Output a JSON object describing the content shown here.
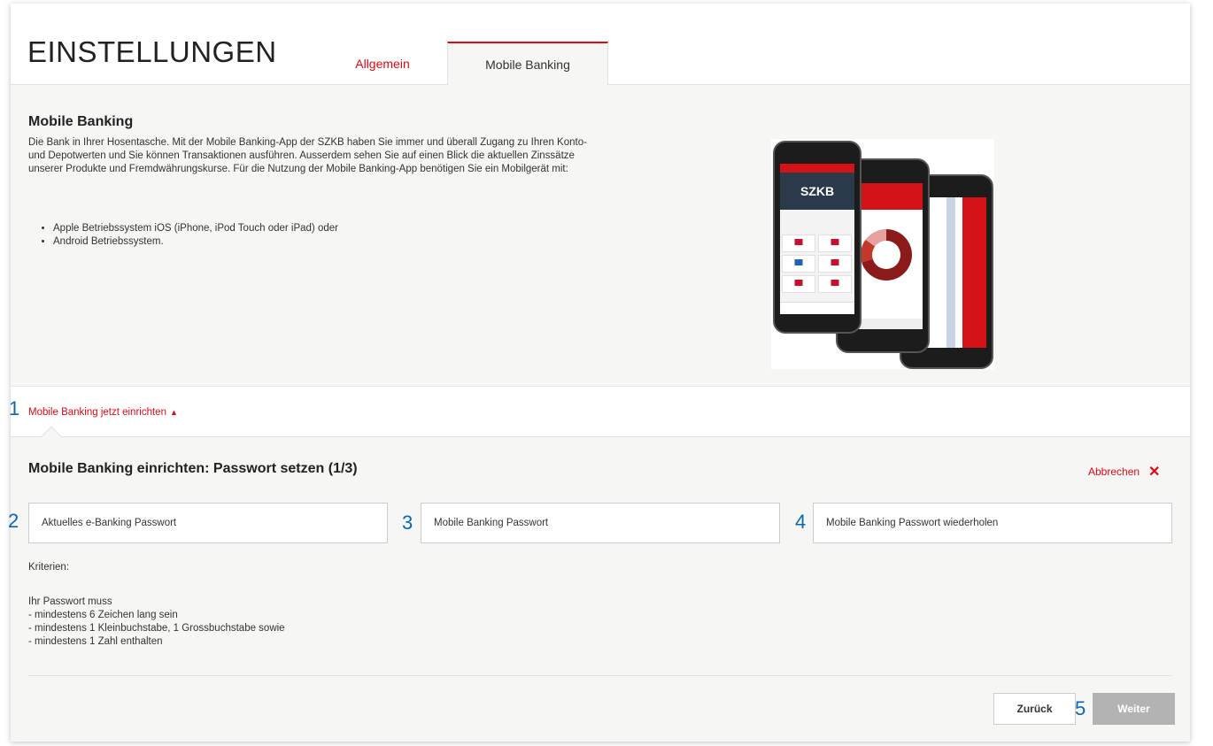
{
  "header": {
    "title": "EINSTELLUNGEN",
    "tabs": [
      {
        "label": "Allgemein",
        "active": false
      },
      {
        "label": "Mobile Banking",
        "active": true
      }
    ]
  },
  "info": {
    "title": "Mobile Banking",
    "text": "Die Bank in Ihrer Hosentasche. Mit der Mobile Banking-App der SZKB haben Sie immer und überall Zugang zu Ihren Konto- und Depotwerten und Sie können Transaktionen ausführen. Ausserdem sehen Sie auf einen Blick die aktuellen Zinssätze unserer Produkte und Fremdwährungskurse. Für die Nutzung der Mobile Banking-App benötigen Sie ein Mobilgerät mit:",
    "list": [
      "Apple Betriebssystem iOS (iPhone, iPod Touch oder iPad) oder",
      "Android Betriebssystem."
    ],
    "image": {
      "banner": "SZKB"
    }
  },
  "expander": {
    "label": "Mobile Banking jetzt einrichten",
    "icon": "chevron-up-icon"
  },
  "form": {
    "title": "Mobile Banking einrichten: Passwort setzen (1/3)",
    "cancel_label": "Abbrechen",
    "fields": [
      {
        "placeholder": "Aktuelles e-Banking Passwort"
      },
      {
        "placeholder": "Mobile Banking Passwort"
      },
      {
        "placeholder": "Mobile Banking Passwort wiederholen"
      }
    ],
    "criteria_title": "Kriterien:",
    "criteria_lines": [
      "Ihr Passwort muss",
      "- mindestens 6 Zeichen lang sein",
      "- mindestens 1 Kleinbuchstabe, 1 Grossbuchstabe sowie",
      "- mindestens 1 Zahl enthalten"
    ],
    "back_label": "Zurück",
    "next_label": "Weiter"
  },
  "markers": [
    "1",
    "2",
    "3",
    "4",
    "5"
  ],
  "colors": {
    "accent": "#e30613",
    "marker": "#0a66b7",
    "disabled_button": "#b3b3b3"
  }
}
